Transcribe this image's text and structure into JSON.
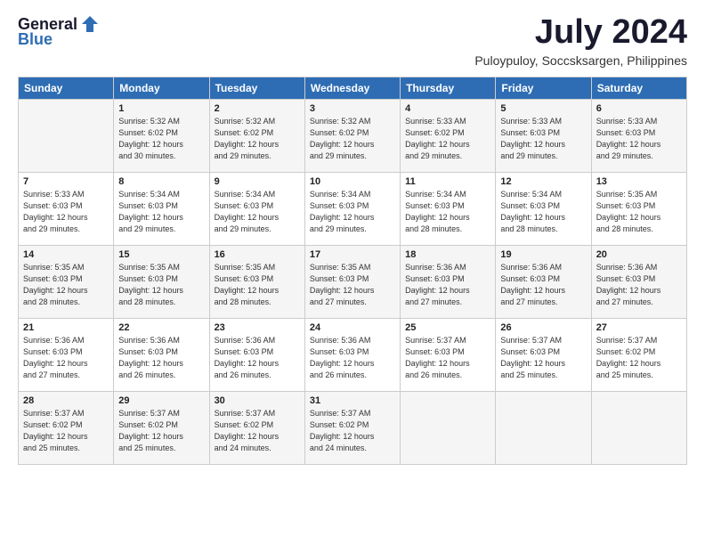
{
  "logo": {
    "general": "General",
    "blue": "Blue"
  },
  "title": "July 2024",
  "location": "Puloypuloy, Soccsksargen, Philippines",
  "days_header": [
    "Sunday",
    "Monday",
    "Tuesday",
    "Wednesday",
    "Thursday",
    "Friday",
    "Saturday"
  ],
  "weeks": [
    [
      {
        "day": "",
        "info": ""
      },
      {
        "day": "1",
        "info": "Sunrise: 5:32 AM\nSunset: 6:02 PM\nDaylight: 12 hours\nand 30 minutes."
      },
      {
        "day": "2",
        "info": "Sunrise: 5:32 AM\nSunset: 6:02 PM\nDaylight: 12 hours\nand 29 minutes."
      },
      {
        "day": "3",
        "info": "Sunrise: 5:32 AM\nSunset: 6:02 PM\nDaylight: 12 hours\nand 29 minutes."
      },
      {
        "day": "4",
        "info": "Sunrise: 5:33 AM\nSunset: 6:02 PM\nDaylight: 12 hours\nand 29 minutes."
      },
      {
        "day": "5",
        "info": "Sunrise: 5:33 AM\nSunset: 6:03 PM\nDaylight: 12 hours\nand 29 minutes."
      },
      {
        "day": "6",
        "info": "Sunrise: 5:33 AM\nSunset: 6:03 PM\nDaylight: 12 hours\nand 29 minutes."
      }
    ],
    [
      {
        "day": "7",
        "info": "Sunrise: 5:33 AM\nSunset: 6:03 PM\nDaylight: 12 hours\nand 29 minutes."
      },
      {
        "day": "8",
        "info": "Sunrise: 5:34 AM\nSunset: 6:03 PM\nDaylight: 12 hours\nand 29 minutes."
      },
      {
        "day": "9",
        "info": "Sunrise: 5:34 AM\nSunset: 6:03 PM\nDaylight: 12 hours\nand 29 minutes."
      },
      {
        "day": "10",
        "info": "Sunrise: 5:34 AM\nSunset: 6:03 PM\nDaylight: 12 hours\nand 29 minutes."
      },
      {
        "day": "11",
        "info": "Sunrise: 5:34 AM\nSunset: 6:03 PM\nDaylight: 12 hours\nand 28 minutes."
      },
      {
        "day": "12",
        "info": "Sunrise: 5:34 AM\nSunset: 6:03 PM\nDaylight: 12 hours\nand 28 minutes."
      },
      {
        "day": "13",
        "info": "Sunrise: 5:35 AM\nSunset: 6:03 PM\nDaylight: 12 hours\nand 28 minutes."
      }
    ],
    [
      {
        "day": "14",
        "info": "Sunrise: 5:35 AM\nSunset: 6:03 PM\nDaylight: 12 hours\nand 28 minutes."
      },
      {
        "day": "15",
        "info": "Sunrise: 5:35 AM\nSunset: 6:03 PM\nDaylight: 12 hours\nand 28 minutes."
      },
      {
        "day": "16",
        "info": "Sunrise: 5:35 AM\nSunset: 6:03 PM\nDaylight: 12 hours\nand 28 minutes."
      },
      {
        "day": "17",
        "info": "Sunrise: 5:35 AM\nSunset: 6:03 PM\nDaylight: 12 hours\nand 27 minutes."
      },
      {
        "day": "18",
        "info": "Sunrise: 5:36 AM\nSunset: 6:03 PM\nDaylight: 12 hours\nand 27 minutes."
      },
      {
        "day": "19",
        "info": "Sunrise: 5:36 AM\nSunset: 6:03 PM\nDaylight: 12 hours\nand 27 minutes."
      },
      {
        "day": "20",
        "info": "Sunrise: 5:36 AM\nSunset: 6:03 PM\nDaylight: 12 hours\nand 27 minutes."
      }
    ],
    [
      {
        "day": "21",
        "info": "Sunrise: 5:36 AM\nSunset: 6:03 PM\nDaylight: 12 hours\nand 27 minutes."
      },
      {
        "day": "22",
        "info": "Sunrise: 5:36 AM\nSunset: 6:03 PM\nDaylight: 12 hours\nand 26 minutes."
      },
      {
        "day": "23",
        "info": "Sunrise: 5:36 AM\nSunset: 6:03 PM\nDaylight: 12 hours\nand 26 minutes."
      },
      {
        "day": "24",
        "info": "Sunrise: 5:36 AM\nSunset: 6:03 PM\nDaylight: 12 hours\nand 26 minutes."
      },
      {
        "day": "25",
        "info": "Sunrise: 5:37 AM\nSunset: 6:03 PM\nDaylight: 12 hours\nand 26 minutes."
      },
      {
        "day": "26",
        "info": "Sunrise: 5:37 AM\nSunset: 6:03 PM\nDaylight: 12 hours\nand 25 minutes."
      },
      {
        "day": "27",
        "info": "Sunrise: 5:37 AM\nSunset: 6:02 PM\nDaylight: 12 hours\nand 25 minutes."
      }
    ],
    [
      {
        "day": "28",
        "info": "Sunrise: 5:37 AM\nSunset: 6:02 PM\nDaylight: 12 hours\nand 25 minutes."
      },
      {
        "day": "29",
        "info": "Sunrise: 5:37 AM\nSunset: 6:02 PM\nDaylight: 12 hours\nand 25 minutes."
      },
      {
        "day": "30",
        "info": "Sunrise: 5:37 AM\nSunset: 6:02 PM\nDaylight: 12 hours\nand 24 minutes."
      },
      {
        "day": "31",
        "info": "Sunrise: 5:37 AM\nSunset: 6:02 PM\nDaylight: 12 hours\nand 24 minutes."
      },
      {
        "day": "",
        "info": ""
      },
      {
        "day": "",
        "info": ""
      },
      {
        "day": "",
        "info": ""
      }
    ]
  ]
}
